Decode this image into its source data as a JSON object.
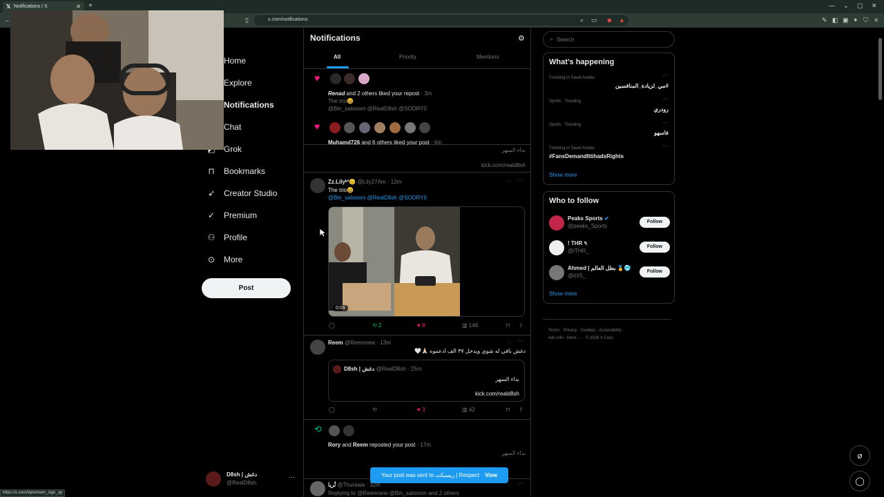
{
  "browser": {
    "tab_title": "Notifications / X",
    "url": "x.com/notifications",
    "status_url": "https://x.com/i/premium_sign_up"
  },
  "nav": {
    "items": [
      {
        "label": "Home",
        "icon": "home-icon"
      },
      {
        "label": "Explore",
        "icon": "search-icon"
      },
      {
        "label": "Notifications",
        "icon": "bell-icon"
      },
      {
        "label": "Chat",
        "icon": "chat-icon"
      },
      {
        "label": "Grok",
        "icon": "grok-icon"
      },
      {
        "label": "Bookmarks",
        "icon": "bookmark-icon"
      },
      {
        "label": "Creator Studio",
        "icon": "rocket-icon"
      },
      {
        "label": "Premium",
        "icon": "verified-icon"
      },
      {
        "label": "Profile",
        "icon": "person-icon"
      },
      {
        "label": "More",
        "icon": "more-circle-icon"
      }
    ],
    "post_label": "Post",
    "account": {
      "name": "D8sh | دغش",
      "handle": "@RealD8sh"
    }
  },
  "main": {
    "title": "Notifications",
    "tabs": [
      "All",
      "Priority",
      "Mentions"
    ],
    "n1": {
      "actor": "Renad",
      "text": " and 2 others liked your repost",
      "time": "· 3m",
      "body": "The trio😆",
      "mentions": "@Bin_salooom @RealD8sh @SODRY0"
    },
    "n2": {
      "actor": "Muhamd726",
      "text": " and 6 others liked your post",
      "time": "· 6m",
      "body_ar": "بداء السهر",
      "link": "kick.com/reald8sh"
    },
    "t1": {
      "name": "Zz.Lilyᵏ²😊",
      "handle": "@Lily27Am",
      "time": "· 12m",
      "body": "The trio😆",
      "mentions": "@Bin_salooom @RealD8sh @SODRY0",
      "duration": "0:09",
      "retweets": "2",
      "likes": "8",
      "views": "148"
    },
    "t2": {
      "name": "Reem",
      "handle": "@Reemoew",
      "time": "· 13m",
      "body": "دغش باقي له شوي ويدخل ٣٧ الف ادعموه 🙏🏻🤍",
      "quote_name": "D8sh | دغش",
      "quote_handle": "@RealD8sh",
      "quote_time": "· 25m",
      "quote_ar": "بداء السهر",
      "quote_link": "kick.com/reald8sh",
      "likes": "3",
      "views": "42"
    },
    "n3": {
      "actor1": "Rory",
      "and": " and ",
      "actor2": "Reem",
      "text": " reposted your post",
      "time": "· 17m",
      "body_ar": "بداء السهر"
    },
    "t3": {
      "name": "ثُريا",
      "handle": "@Thuraaia",
      "time": "· 32m",
      "replying": "Replying to @Reemoew @Bin_salooom and 2 others"
    }
  },
  "right": {
    "search_placeholder": "Search",
    "happening_title": "What’s happening",
    "trends": [
      {
        "context": "Trending in Saudi Arabia",
        "topic": "#مي_لزيادة_المنافسين"
      },
      {
        "context": "Sports · Trending",
        "topic": "رودري"
      },
      {
        "context": "Sports · Trending",
        "topic": "فاسهو"
      },
      {
        "context": "Trending in Saudi Arabia",
        "topic": "#FansDemandIttihadsRights"
      }
    ],
    "show_more": "Show more",
    "wtf_title": "Who to follow",
    "follow": [
      {
        "name": "Peaks Sports",
        "handle": "@peaks_Sports",
        "button": "Follow"
      },
      {
        "name": "! THR ٩",
        "handle": "@iTHR_",
        "button": "Follow"
      },
      {
        "name": "Ahmed | بطل العالم 🏅🥶",
        "handle": "@itX5_",
        "button": "Follow"
      }
    ],
    "footer": [
      "Terms",
      "Privacy",
      "Cookies",
      "Accessibility",
      "Ads info",
      "More ···",
      "© 2026 X Corp."
    ]
  },
  "toast": {
    "text": "Your post was sent to ريسبكت | Respect",
    "action": "View"
  }
}
